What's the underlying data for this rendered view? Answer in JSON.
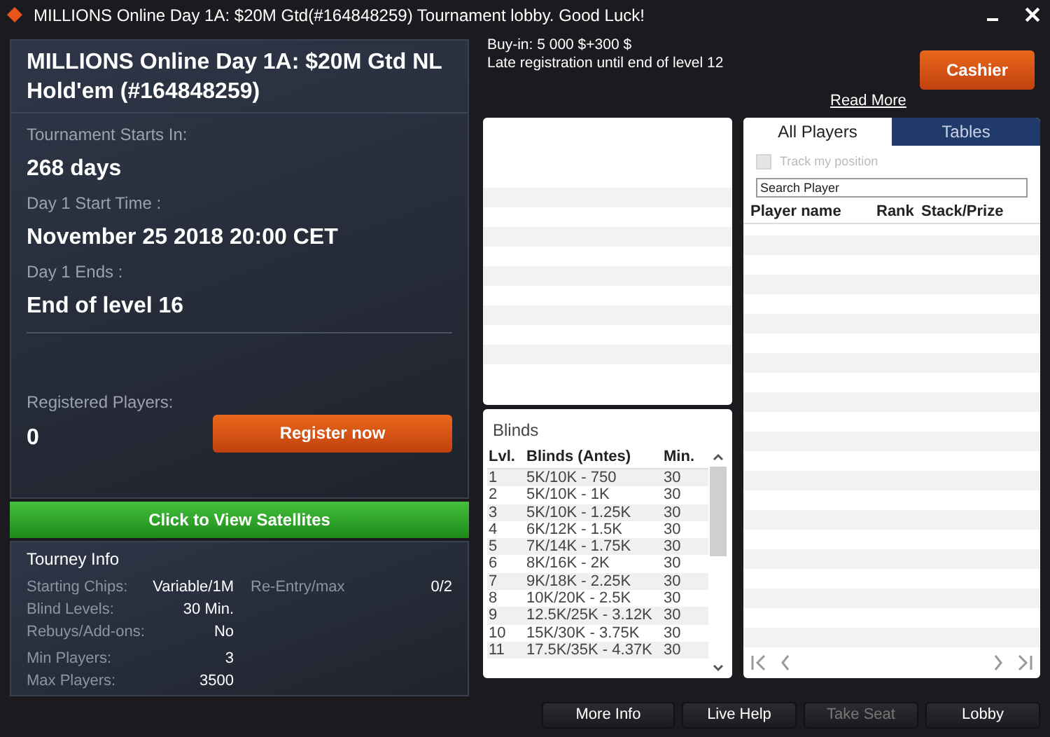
{
  "window": {
    "title": "MILLIONS Online Day 1A: $20M Gtd(#164848259) Tournament lobby. Good Luck!"
  },
  "header": {
    "buy_in": "Buy-in: 5 000 $+300 $",
    "late_reg": "Late registration until end of level 12",
    "read_more": "Read More",
    "cashier": "Cashier"
  },
  "tournament": {
    "title": "MILLIONS Online Day 1A: $20M Gtd NL Hold'em (#164848259)",
    "fields": [
      {
        "label": "Tournament Starts In:",
        "value": "268 days"
      },
      {
        "label": "Day 1 Start Time :",
        "value": "November 25 2018  20:00 CET"
      },
      {
        "label": "Day 1 Ends :",
        "value": "End of level 16"
      }
    ],
    "registered_label": "Registered Players:",
    "registered_value": "0",
    "register_button": "Register now"
  },
  "satellites_button": "Click to View Satellites",
  "tourney_info": {
    "title": "Tourney Info",
    "rows": [
      {
        "label": "Starting Chips:",
        "value": "Variable/1M"
      },
      {
        "label": "Blind Levels:",
        "value": "30 Min."
      },
      {
        "label": "Rebuys/Add-ons:",
        "value": "No"
      },
      {
        "label": "Min Players:",
        "value": "3"
      },
      {
        "label": "Max Players:",
        "value": "3500"
      }
    ],
    "reentry_label": "Re-Entry/max",
    "reentry_value": "0/2"
  },
  "blinds": {
    "title": "Blinds",
    "columns": [
      "Lvl.",
      "Blinds (Antes)",
      "Min."
    ],
    "rows": [
      [
        "1",
        "5K/10K - 750",
        "30"
      ],
      [
        "2",
        "5K/10K - 1K",
        "30"
      ],
      [
        "3",
        "5K/10K - 1.25K",
        "30"
      ],
      [
        "4",
        "6K/12K - 1.5K",
        "30"
      ],
      [
        "5",
        "7K/14K - 1.75K",
        "30"
      ],
      [
        "6",
        "8K/16K - 2K",
        "30"
      ],
      [
        "7",
        "9K/18K - 2.25K",
        "30"
      ],
      [
        "8",
        "10K/20K - 2.5K",
        "30"
      ],
      [
        "9",
        "12.5K/25K - 3.12K",
        "30"
      ],
      [
        "10",
        "15K/30K - 3.75K",
        "30"
      ],
      [
        "11",
        "17.5K/35K - 4.37K",
        "30"
      ]
    ]
  },
  "players": {
    "tabs": [
      {
        "label": "All Players",
        "selected": true
      },
      {
        "label": "Tables",
        "selected": false
      }
    ],
    "track": {
      "label": "Track my position",
      "checked": false,
      "disabled": true
    },
    "search": {
      "placeholder": "Search Player"
    },
    "columns": [
      "Player name",
      "Rank",
      "Stack/Prize"
    ]
  },
  "footer": [
    {
      "label": "More Info",
      "disabled": false
    },
    {
      "label": "Live Help",
      "disabled": false
    },
    {
      "label": "Take Seat",
      "disabled": true
    },
    {
      "label": "Lobby",
      "disabled": false
    }
  ]
}
